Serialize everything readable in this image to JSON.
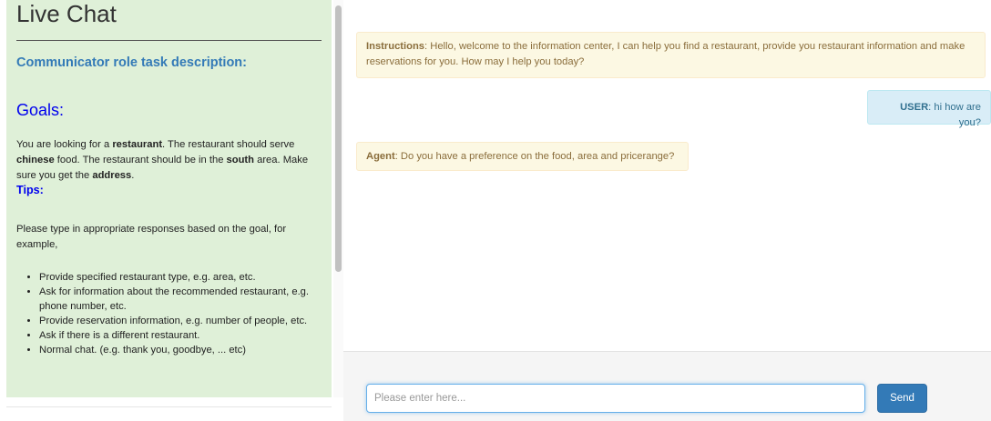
{
  "sidebar": {
    "title": "Live Chat",
    "role_heading": "Communicator role task description:",
    "goals_heading": "Goals:",
    "goal": {
      "p1": "You are looking for a ",
      "b1": "restaurant",
      "p2": ". The restaurant should serve ",
      "b2": "chinese",
      "p3": " food. The restaurant should be in the ",
      "b3": "south",
      "p4": " area. Make sure you get the ",
      "b4": "address",
      "p5": "."
    },
    "tips_heading": "Tips:",
    "tips_intro": "Please type in appropriate responses based on the goal, for example,",
    "tips": [
      "Provide specified restaurant type, e.g. area, etc.",
      "Ask for information about the recommended restaurant, e.g. phone number, etc.",
      "Provide reservation information, e.g. number of people, etc.",
      "Ask if there is a different restaurant.",
      "Normal chat. (e.g. thank you, goodbye, ... etc)"
    ]
  },
  "chat": {
    "messages": [
      {
        "who": "Instructions",
        "sep": ": ",
        "text": "Hello, welcome to the information center, I can help you find a restaurant, provide you restaurant information and make reservations for you. How may I help you today?"
      },
      {
        "who": "USER",
        "sep": ": ",
        "text": "hi how are you?"
      },
      {
        "who": "Agent",
        "sep": ": ",
        "text": "Do you have a preference on the food, area and pricerange?"
      }
    ],
    "input_placeholder": "Please enter here...",
    "input_value": "",
    "send_label": "Send"
  },
  "colors": {
    "sidebar_bg": "#dff0d8",
    "heading_blue": "#337ab7",
    "link_blue": "#0000ee",
    "warning_bg": "#fcf8e3",
    "warning_text": "#8a6d3b",
    "info_bg": "#d9edf7",
    "info_text": "#31708f",
    "primary_button": "#337ab7"
  }
}
